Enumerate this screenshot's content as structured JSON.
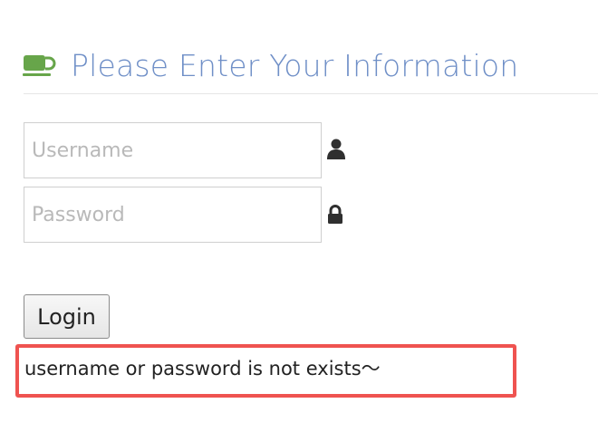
{
  "header": {
    "icon": "coffee-cup-icon",
    "title": "Please Enter Your Information"
  },
  "form": {
    "username": {
      "placeholder": "Username",
      "value": "",
      "icon": "user-icon"
    },
    "password": {
      "placeholder": "Password",
      "value": "",
      "icon": "lock-icon"
    },
    "login_label": "Login"
  },
  "error": {
    "message": "username or password is not exists～"
  },
  "colors": {
    "title": "#6f8fc7",
    "cup_icon": "#67a54a",
    "highlight_border": "#ef5350"
  }
}
